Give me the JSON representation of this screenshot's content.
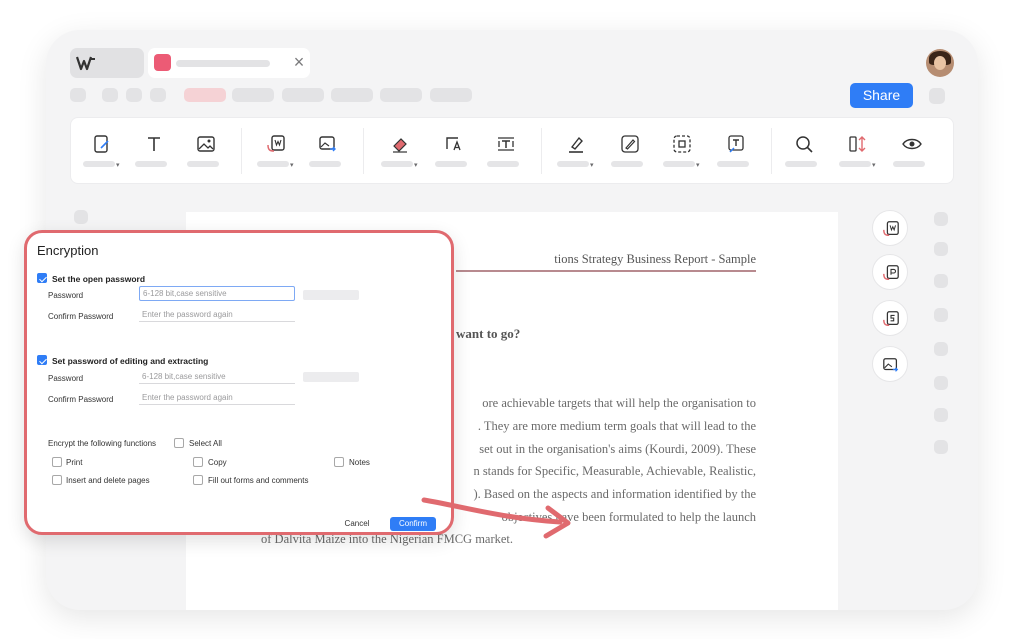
{
  "header": {
    "share_label": "Share"
  },
  "document": {
    "header_text": "tions Strategy Business Report - Sample",
    "question": "want to go?",
    "lines": [
      "ore achievable targets that will help the organisation to",
      ". They are more medium term goals that will lead to the",
      "set out in the organisation's aims (Kourdi, 2009). These",
      "n stands for Specific, Measurable, Achievable, Realistic,",
      "). Based on the aspects and information identified by the",
      "objectives have been formulated to help the launch",
      "of Dalvita Maize into the Nigerian FMCG market."
    ]
  },
  "dialog": {
    "title": "Encryption",
    "open_password": {
      "label": "Set the open password",
      "checked": true,
      "password_label": "Password",
      "password_placeholder": "6-128 bit,case sensitive",
      "confirm_label": "Confirm Password",
      "confirm_placeholder": "Enter the password again"
    },
    "edit_password": {
      "label": "Set password of editing and extracting",
      "checked": true,
      "password_label": "Password",
      "password_placeholder": "6-128 bit,case sensitive",
      "confirm_label": "Confirm Password",
      "confirm_placeholder": "Enter the password again"
    },
    "functions": {
      "label": "Encrypt the following functions",
      "select_all": "Select All",
      "options": [
        "Print",
        "Copy",
        "Notes",
        "Insert and delete pages",
        "Fill out forms and comments"
      ]
    },
    "cancel_label": "Cancel",
    "confirm_label": "Confirm"
  },
  "colors": {
    "accent": "#2f7df6",
    "dialog_border": "#e06a6f",
    "pdf_badge": "#ec5b75"
  }
}
